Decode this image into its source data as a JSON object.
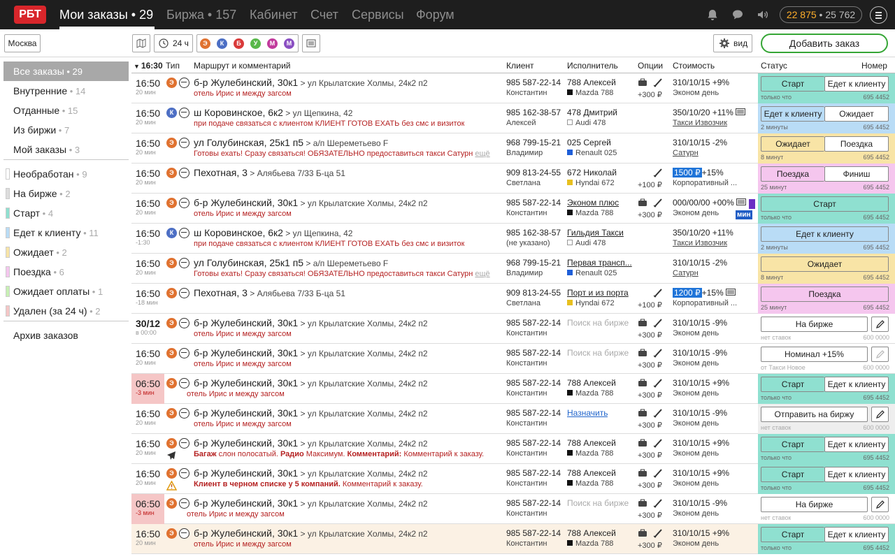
{
  "header": {
    "logo": "РБТ",
    "nav": [
      {
        "label": "Мои заказы • 29",
        "active": true
      },
      {
        "label": "Биржа • 157",
        "active": false
      },
      {
        "label": "Кабинет",
        "active": false
      },
      {
        "label": "Счет",
        "active": false
      },
      {
        "label": "Сервисы",
        "active": false
      },
      {
        "label": "Форум",
        "active": false
      }
    ],
    "icons": [
      "bell-icon",
      "chat-icon",
      "sound-icon"
    ],
    "balance_main": "22 875",
    "balance_sep": " • ",
    "balance_secondary": "25 762"
  },
  "toolbar": {
    "city": "Москва",
    "period": "24 ч",
    "filter_badges": [
      {
        "letter": "Э",
        "color": "#e07230"
      },
      {
        "letter": "К",
        "color": "#4d6fc4"
      },
      {
        "letter": "Б",
        "color": "#d93a3a"
      },
      {
        "letter": "У",
        "color": "#58b84a"
      },
      {
        "letter": "М",
        "color": "#c13a9c"
      },
      {
        "letter": "М",
        "color": "#8a4fc2"
      }
    ],
    "view_label": "вид",
    "add_order_label": "Добавить заказ"
  },
  "sidebar": {
    "groups": [
      [
        {
          "label": "Все заказы",
          "count": "29",
          "selected": true
        },
        {
          "label": "Внутренние",
          "count": "14"
        },
        {
          "label": "Отданные",
          "count": "15"
        },
        {
          "label": "Из биржи",
          "count": "7"
        },
        {
          "label": "Мой заказы",
          "count": "3"
        }
      ],
      [
        {
          "label": "Необработан",
          "count": "9",
          "swatch": "#ffffff"
        },
        {
          "label": "На бирже",
          "count": "2",
          "swatch": "#dddddd"
        },
        {
          "label": "Старт",
          "count": "4",
          "swatch": "#8fe0d0"
        },
        {
          "label": "Едет к клиенту",
          "count": "11",
          "swatch": "#b9dcf6"
        },
        {
          "label": "Ожидает",
          "count": "2",
          "swatch": "#f8e4a6"
        },
        {
          "label": "Поездка",
          "count": "6",
          "swatch": "#f5c6ee"
        },
        {
          "label": "Ожидает оплаты",
          "count": "1",
          "swatch": "#c8f0b4"
        },
        {
          "label": "Удален (за 24 ч)",
          "count": "2",
          "swatch": "#f5c6c6"
        }
      ],
      [
        {
          "label": "Архив заказов",
          "count": ""
        }
      ]
    ]
  },
  "table": {
    "headers": {
      "time": "16:30",
      "type": "Тип",
      "route": "Маршрут и комментарий",
      "client": "Клиент",
      "executor": "Исполнитель",
      "options": "Опции",
      "price": "Стоимость",
      "status": "Статус",
      "number": "Номер"
    },
    "rows": [
      {
        "time": "16:50",
        "ago": "20 мин",
        "cls": "Э",
        "from": "б-р Жулебинский, 30к1",
        "to": "ул Крылатские Холмы, 24к2 п2",
        "comment": "отель Ирис и между загсом",
        "phone": "985 587-22-14",
        "client": "Константин",
        "executor": "788 Алексей",
        "car": "Mazda 788",
        "car_color": "#111111",
        "options": "+300 ₽",
        "price": "310/10/15 +9%",
        "tariff": "Эконом день",
        "status_bg": "#8fe0d0",
        "btn_left": "Старт",
        "btn_right": "Едет к клиенту",
        "status_time": "только что",
        "number": "695 4452"
      },
      {
        "time": "16:50",
        "ago": "20 мин",
        "cls": "К",
        "from": "ш Коровинское, 6к2",
        "to": "ул Щепкина, 42",
        "comment": "при подаче связаться с клиентом КЛИЕНТ ГОТОВ ЕХАТЬ без смс и визиток",
        "phone": "985 162-38-57",
        "client": "Алексей",
        "executor": "478 Дмитрий",
        "car": "Audi 478",
        "car_color": "#ffffff",
        "options": "",
        "price": "350/10/20 +11%",
        "tariff": "Такси Извозчик",
        "status_bg": "#b9dcf6",
        "btn_left": "Едет к клиенту",
        "btn_right": "Ожидает",
        "status_time": "2 минуты",
        "number": "695 4452"
      },
      {
        "time": "16:50",
        "ago": "20 мин",
        "cls": "Э",
        "from": "ул Голубинская, 25к1 п5",
        "to": "а/п Шереметьево F",
        "comment": "Готовы ехать! Сразу связаться! ОБЯЗАТЕЛЬНО предоставиться такси Сатурн",
        "more": "ещё",
        "phone": "968 799-15-21",
        "client": "Владимир",
        "executor": "025 Сергей",
        "car": "Renault 025",
        "car_color": "#1f5fd8",
        "options": "",
        "price": "310/10/15 -2%",
        "tariff": "Сатурн",
        "status_bg": "#f8e4a6",
        "btn_left": "Ожидает",
        "btn_right": "Поездка",
        "status_time": "8 минут",
        "number": "695 4452"
      },
      {
        "time": "16:50",
        "ago": "20 мин",
        "cls": "Э",
        "from": "Пехотная, 3",
        "to": "Алябьева 7/33 Б-ца 51",
        "comment": "",
        "phone": "909 813-24-55",
        "client": "Светлана",
        "executor": "672 Николай",
        "car": "Hyndai 672",
        "car_color": "#e8c020",
        "options": "+100 ₽",
        "price_hl": "1500 ₽",
        "price": "+15%",
        "tariff": "Корпоративный ...",
        "status_bg": "#f5c6ee",
        "btn_left": "Поездка",
        "btn_right": "Финиш",
        "status_time": "25 минут",
        "number": "695 4452"
      },
      {
        "time": "16:50",
        "ago": "20 мин",
        "cls": "Э",
        "from": "б-р Жулебинский, 30к1",
        "to": "ул Крылатские Холмы, 24к2 п2",
        "comment": "отель Ирис и между загсом",
        "phone": "985 587-22-14",
        "client": "Константин",
        "executor": "Эконом плюс",
        "car": "Mazda 788",
        "car_color": "#111111",
        "options": "+300 ₽",
        "price": "000/00/00 +00%",
        "tariff": "Эконом день",
        "tag": "мин",
        "status_bg": "#8fe0d0",
        "btn_full": "Старт",
        "status_time": "только что",
        "number": "695 4452"
      },
      {
        "time": "16:50",
        "ago": "-1:30",
        "cls": "К",
        "from": "ш Коровинское, 6к2",
        "to": "ул Щепкина, 42",
        "comment": "при подаче связаться с клиентом КЛИЕНТ ГОТОВ ЕХАТЬ без смс и визиток",
        "phone": "985 162-38-57",
        "client": "(не указано)",
        "executor": "Гильдия Такси",
        "car": "Audi 478",
        "car_color": "#ffffff",
        "options": "",
        "price": "350/10/20 +11%",
        "tariff": "Такси Извозчик",
        "status_bg": "#b9dcf6",
        "btn_full": "Едет к клиенту",
        "status_time": "2 минуты",
        "number": "695 4452"
      },
      {
        "time": "16:50",
        "ago": "20 мин",
        "cls": "Э",
        "from": "ул Голубинская, 25к1 п5",
        "to": "а/п Шереметьево F",
        "comment": "Готовы ехать! Сразу связаться! ОБЯЗАТЕЛЬНО предоставиться такси Сатурн",
        "more": "ещё",
        "phone": "968 799-15-21",
        "client": "Владимир",
        "executor": "Первая трансп...",
        "car": "Renault 025",
        "car_color": "#1f5fd8",
        "options": "",
        "price": "310/10/15 -2%",
        "tariff": "Сатурн",
        "status_bg": "#f8e4a6",
        "btn_full": "Ожидает",
        "status_time": "8 минут",
        "number": "695 4452"
      },
      {
        "time": "16:50",
        "ago": "-18 мин",
        "cls": "Э",
        "from": "Пехотная, 3",
        "to": "Алябьева 7/33 Б-ца 51",
        "comment": "",
        "phone": "909 813-24-55",
        "client": "Светлана",
        "executor": "Порт и из порта",
        "car": "Hyndai 672",
        "car_color": "#e8c020",
        "options": "+100 ₽",
        "price_hl": "1200 ₽",
        "price": "+15%",
        "tariff": "Корпоративный ...",
        "status_bg": "#f5c6ee",
        "btn_full": "Поездка",
        "status_time": "25 минут",
        "number": "695 4452"
      },
      {
        "time": "30/12",
        "ago": "в 00:00",
        "cls": "Э",
        "from": "б-р Жулебинский, 30к1",
        "to": "ул Крылатские Холмы, 24к2 п2",
        "comment": "отель Ирис и между загсом",
        "phone": "985 587-22-14",
        "client": "Константин",
        "executor": "Поиск на бирже",
        "car": "",
        "options": "+300 ₽",
        "price": "310/10/15 -9%",
        "tariff": "Эконом день",
        "btn_wide": "На бирже",
        "status_time": "нет ставок",
        "number": "600 0000"
      },
      {
        "time": "16:50",
        "ago": "20 мин",
        "cls": "Э",
        "from": "б-р Жулебинский, 30к1",
        "to": "ул Крылатские Холмы, 24к2 п2",
        "comment": "отель Ирис и между загсом",
        "phone": "985 587-22-14",
        "client": "Константин",
        "executor": "Поиск на бирже",
        "car": "",
        "options": "+300 ₽",
        "price": "310/10/15 -9%",
        "tariff": "Эконом день",
        "btn_wide": "Номинал +15%",
        "status_time": "от Такси Новое",
        "number": "600 0000"
      },
      {
        "time": "06:50",
        "ago": "-3 мин",
        "late": true,
        "cls": "Э",
        "from": "б-р Жулебинский, 30к1",
        "to": "ул Крылатские Холмы, 24к2 п2",
        "comment": "отель Ирис и между загсом",
        "phone": "985 587-22-14",
        "client": "Константин",
        "executor": "788 Алексей",
        "car": "Mazda 788",
        "car_color": "#111111",
        "options": "+300 ₽",
        "price": "310/10/15 +9%",
        "tariff": "Эконом день",
        "status_bg": "#8fe0d0",
        "btn_left": "Старт",
        "btn_right": "Едет к клиенту",
        "status_time": "только что",
        "number": "695 4452"
      },
      {
        "time": "16:50",
        "ago": "20 мин",
        "cls": "Э",
        "from": "б-р Жулебинский, 30к1",
        "to": "ул Крылатские Холмы, 24к2 п2",
        "comment": "отель Ирис и между загсом",
        "phone": "985 587-22-14",
        "client": "Константин",
        "executor": "Назначить",
        "car": "",
        "options": "+300 ₽",
        "price": "310/10/15 -9%",
        "tariff": "Эконом день",
        "status_bg": "#eeeeee",
        "btn_wide": "Отправить на биржу",
        "status_time": "нет ставок",
        "number": "600 0000"
      },
      {
        "time": "16:50",
        "ago": "20 мин",
        "cls": "Э",
        "from": "б-р Жулебинский, 30к1",
        "to": "ул Крылатские Холмы, 24к2 п2",
        "comment_rich": [
          {
            "b": "Багаж"
          },
          {
            "t": " слон полосатый. "
          },
          {
            "b": "Радио"
          },
          {
            "t": " Максимум. "
          },
          {
            "b": "Комментарий:"
          },
          {
            "t": " Комментарий к заказу."
          }
        ],
        "phone": "985 587-22-14",
        "client": "Константин",
        "executor": "788 Алексей",
        "car": "Mazda 788",
        "car_color": "#111111",
        "options": "+300 ₽",
        "price": "310/10/15 +9%",
        "tariff": "Эконом день",
        "status_bg": "#8fe0d0",
        "btn_left": "Старт",
        "btn_right": "Едет к клиенту",
        "status_time": "только что",
        "number": "695 4452",
        "extra_icon": "plane-icon"
      },
      {
        "time": "16:50",
        "ago": "20 мин",
        "cls": "Э",
        "from": "б-р Жулебинский, 30к1",
        "to": "ул Крылатские Холмы, 24к2 п2",
        "comment_rich": [
          {
            "b": "Клиент в черном списке у 5 компаний."
          },
          {
            "t": " Комментарий к заказу."
          }
        ],
        "phone": "985 587-22-14",
        "client": "Константин",
        "executor": "788 Алексей",
        "car": "Mazda 788",
        "car_color": "#111111",
        "options": "+300 ₽",
        "price": "310/10/15 +9%",
        "tariff": "Эконом день",
        "status_bg": "#8fe0d0",
        "btn_left": "Старт",
        "btn_right": "Едет к клиенту",
        "status_time": "только что",
        "number": "695 4452",
        "extra_icon": "warning-icon"
      },
      {
        "time": "06:50",
        "ago": "-3 мин",
        "late": true,
        "cls": "Э",
        "from": "б-р Жулебинский, 30к1",
        "to": "ул Крылатские Холмы, 24к2 п2",
        "comment": "отель Ирис и между загсом",
        "phone": "985 587-22-14",
        "client": "Константин",
        "executor": "Поиск на бирже",
        "car": "",
        "options": "+300 ₽",
        "price": "310/10/15 -9%",
        "tariff": "Эконом день",
        "btn_wide": "На бирже",
        "status_time": "нет ставок",
        "number": "600 0000"
      },
      {
        "time": "16:50",
        "ago": "20 мин",
        "cls": "Э",
        "peach": true,
        "from": "б-р Жулебинский, 30к1",
        "to": "ул Крылатские Холмы, 24к2 п2",
        "comment": "отель Ирис и между загсом",
        "phone": "985 587-22-14",
        "client": "Константин",
        "executor": "788 Алексей",
        "car": "Mazda 788",
        "car_color": "#111111",
        "options": "+300 ₽",
        "price": "310/10/15 +9%",
        "tariff": "Эконом день",
        "status_bg": "#8fe0d0",
        "btn_left": "Старт",
        "btn_right": "Едет к клиенту",
        "status_time": "только что",
        "number": "695 4452"
      }
    ]
  }
}
